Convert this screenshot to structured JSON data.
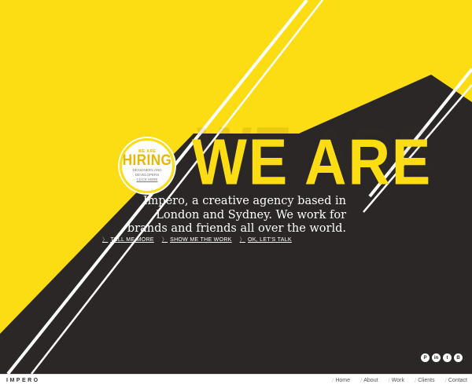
{
  "hero": {
    "headline": "WE ARE",
    "headline_shadow": "WE ARE",
    "tagline": "Impero, a creative agency based in London and Sydney. We work for brands and friends all over the world.",
    "ctas": [
      {
        "label": "TELL ME MORE"
      },
      {
        "label": "SHOW ME THE WORK"
      },
      {
        "label": "OK, LET'S TALK"
      }
    ]
  },
  "badge": {
    "top": "WE ARE",
    "main": "HIRING",
    "desc": "DESIGNERS AND DEVELOPERS",
    "link": "CLICK HERE"
  },
  "social": [
    {
      "icon": "pinterest-icon",
      "glyph": "P"
    },
    {
      "icon": "linkedin-icon",
      "glyph": "in"
    },
    {
      "icon": "twitter-icon",
      "glyph": "t"
    },
    {
      "icon": "behance-icon",
      "glyph": "B"
    }
  ],
  "footer": {
    "logo": "IMPERO",
    "nav": [
      {
        "label": "Home"
      },
      {
        "label": "About"
      },
      {
        "label": "Work"
      },
      {
        "label": "Clients"
      },
      {
        "label": "Contact"
      }
    ]
  },
  "colors": {
    "yellow": "#fcdc12",
    "dark": "#2b2727",
    "white": "#ffffff"
  }
}
